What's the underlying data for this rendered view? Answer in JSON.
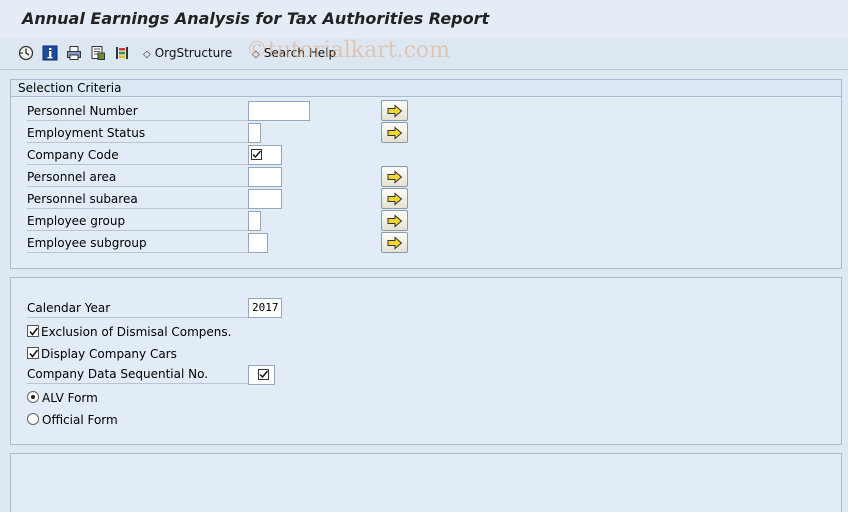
{
  "window": {
    "title": "Annual Earnings Analysis for Tax Authorities Report"
  },
  "toolbar": {
    "icons": [
      "execute-icon",
      "info-icon",
      "print-icon",
      "variant-icon",
      "selection-options-icon"
    ],
    "org_structure_label": "OrgStructure",
    "search_help_label": "Search Help",
    "watermark": "©tutorialkart.com"
  },
  "selection_criteria": {
    "title": "Selection Criteria",
    "rows": [
      {
        "label": "Personnel Number",
        "value": "",
        "has_multi_select": true
      },
      {
        "label": "Employment Status",
        "value": "",
        "has_multi_select": true
      },
      {
        "label": "Company Code",
        "value": "",
        "checkbox_field": true,
        "has_multi_select": false
      },
      {
        "label": "Personnel area",
        "value": "",
        "has_multi_select": true
      },
      {
        "label": "Personnel subarea",
        "value": "",
        "has_multi_select": true
      },
      {
        "label": "Employee group",
        "value": "",
        "has_multi_select": true
      },
      {
        "label": "Employee subgroup",
        "value": "",
        "has_multi_select": true
      }
    ]
  },
  "parameters": {
    "calendar_year_label": "Calendar Year",
    "calendar_year_value": "2017",
    "exclusion_label": "Exclusion of Dismisal Compens.",
    "exclusion_checked": true,
    "display_cars_label": "Display Company Cars",
    "display_cars_checked": true,
    "seq_no_label": "Company Data Sequential No.",
    "seq_no_checked": true,
    "output_options": [
      {
        "label": "ALV Form",
        "selected": true
      },
      {
        "label": "Official Form",
        "selected": false
      }
    ]
  }
}
